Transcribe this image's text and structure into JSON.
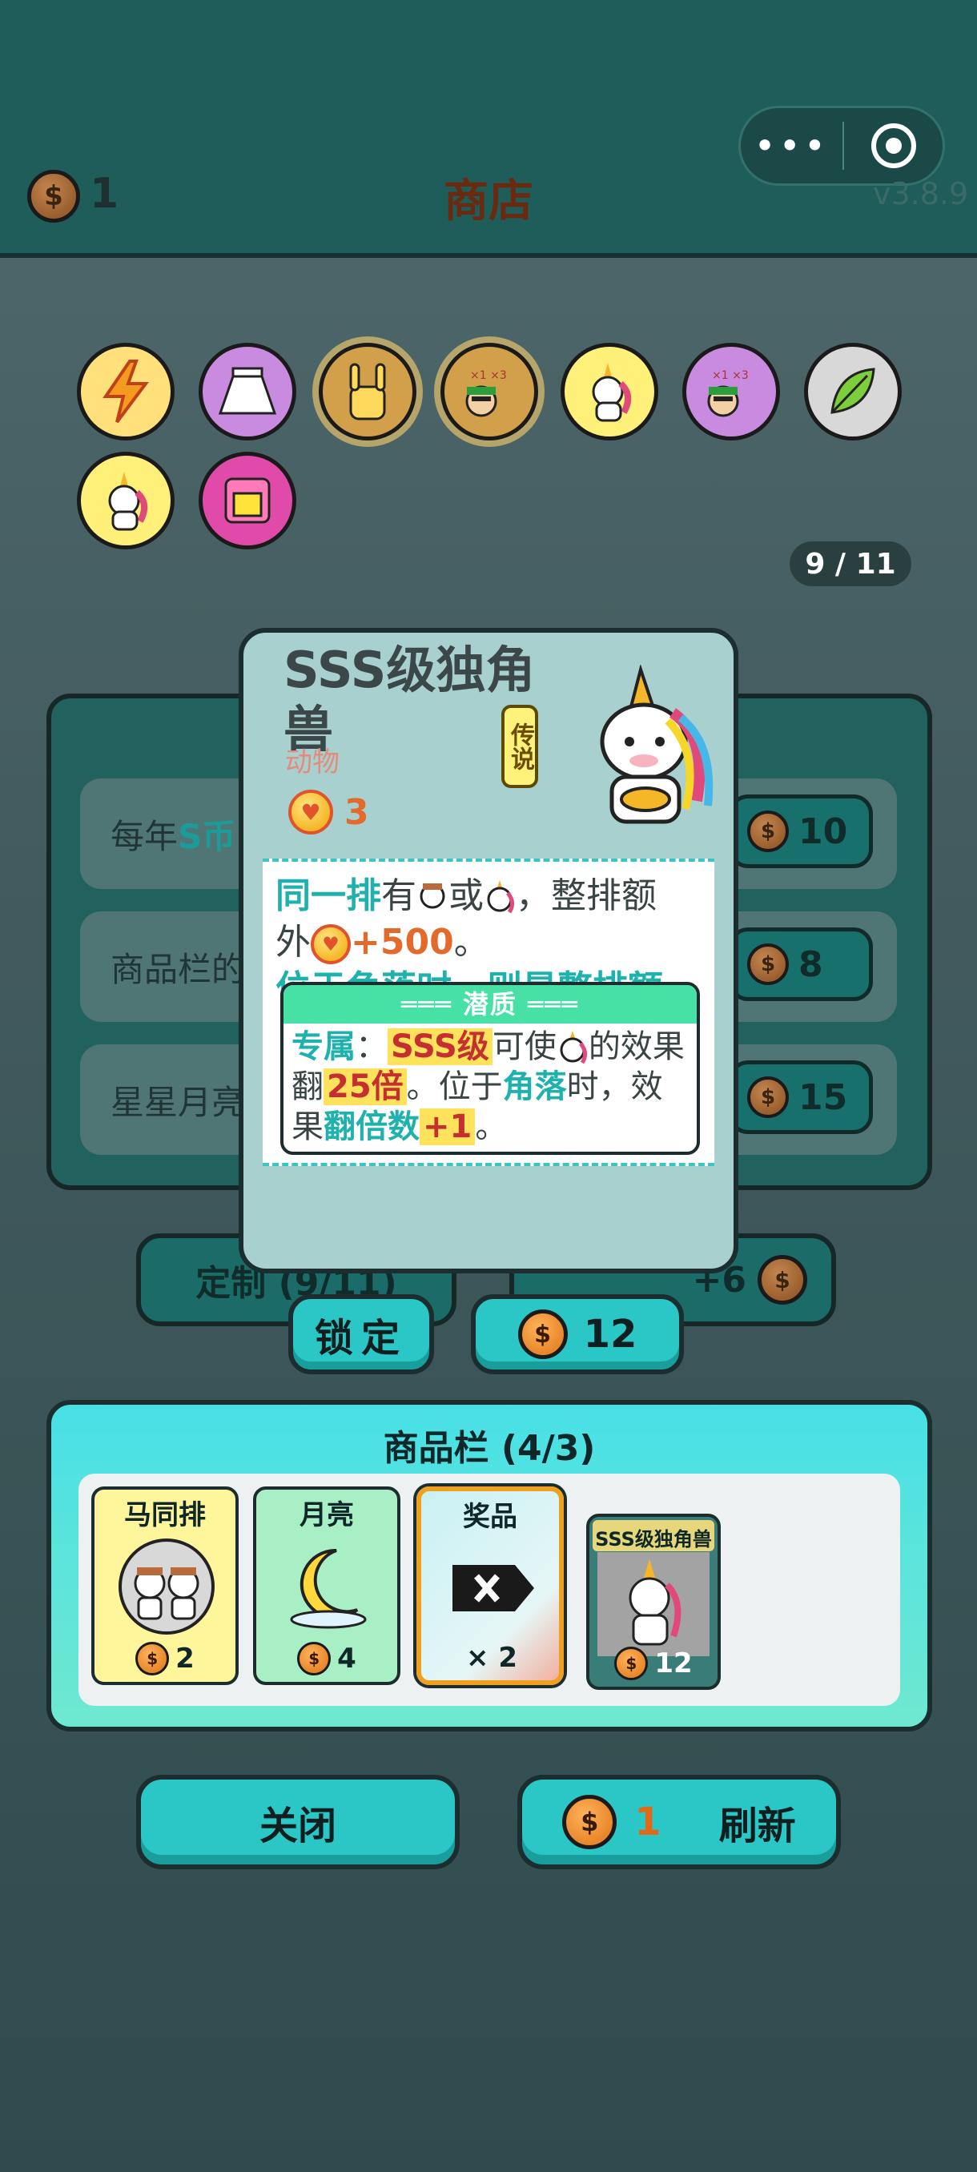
{
  "header": {
    "coin_count": "1",
    "title": "商店",
    "version": "v3.8.9",
    "menu_dots": "•••"
  },
  "relics": [
    {
      "name": "lightning-relic-icon",
      "bg": "#ffe07a"
    },
    {
      "name": "skirt-relic-icon",
      "bg": "#c98be0"
    },
    {
      "name": "rock-hand-relic-icon",
      "bg": "#d2a04a"
    },
    {
      "name": "math-guy-relic-icon",
      "bg": "#d2a04a"
    },
    {
      "name": "unicorn-relic-icon",
      "bg": "#fff07a"
    },
    {
      "name": "math-guy-purple-relic-icon",
      "bg": "#c98be0"
    },
    {
      "name": "leaf-relic-icon",
      "bg": "#d8d8d8"
    },
    {
      "name": "unicorn-relic-2-icon",
      "bg": "#fff07a"
    },
    {
      "name": "pink-box-relic-icon",
      "bg": "#e04aa8"
    }
  ],
  "pager": "9 / 11",
  "background_rows": {
    "row1_prefix": "每年",
    "row1_highlight": "S币",
    "row1_price": "10",
    "row2_text": "商品栏的",
    "row2_price": "8",
    "row3_text": "星星月亮",
    "row3_price": "15",
    "custom_button": "定制 (9/11)",
    "plus_label": "+6"
  },
  "card": {
    "title": "SSS级独角兽",
    "type": "动物",
    "rarity_tag": "传说",
    "cost": "3",
    "desc_line1_a": "同一排",
    "desc_line1_b": "有",
    "desc_line1_c": "或",
    "desc_line1_d": "，整排额",
    "desc_line2_a": "外",
    "desc_line2_b": "+500",
    "desc_line2_c": "。",
    "desc_line3": "位于角落时，则是整排额",
    "quality_header": "═══ 潜质 ═══",
    "q_label": "专属",
    "q_colon": "：",
    "q_sss": "SSS级",
    "q_text1": "可使",
    "q_text2": "的效果翻",
    "q_mult": "25倍",
    "q_text3": "。位于",
    "q_corner": "角落",
    "q_text4": "时，效果",
    "q_double": "翻倍数",
    "q_plus": "+1",
    "q_end": "。"
  },
  "actions": {
    "lock_label": "锁定",
    "buy_price": "12"
  },
  "cart": {
    "title": "商品栏 (4/3)",
    "items": [
      {
        "name": "马同排",
        "price": "2"
      },
      {
        "name": "月亮",
        "price": "4"
      },
      {
        "name": "奖品",
        "extra": "× 2"
      },
      {
        "name": "SSS级独角兽",
        "price": "12"
      }
    ]
  },
  "bottom": {
    "close_label": "关闭",
    "refresh_cost": "1",
    "refresh_label": "刷新"
  },
  "colors": {
    "teal_button": "#2bc7c6",
    "header": "#1f5d5a",
    "coin": "#e8862a",
    "highlight_orange": "#e36a2a",
    "highlight_cyan": "#1fb1ad"
  }
}
